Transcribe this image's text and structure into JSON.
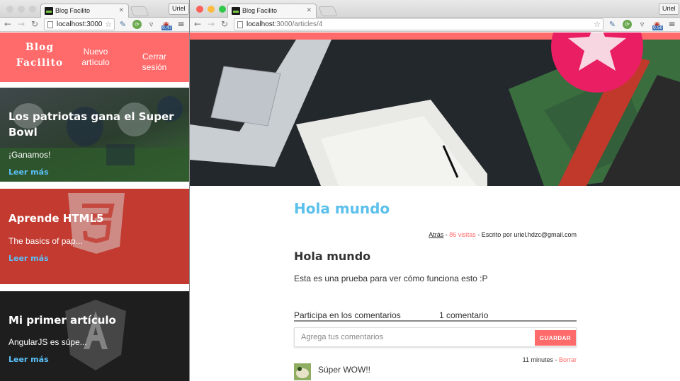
{
  "colors": {
    "brand": "#ff6b6b",
    "link": "#5bc0f8",
    "title": "#5bc0eb"
  },
  "left_window": {
    "tab_title": "Blog Facilito",
    "user": "Uriel",
    "url_host": "localhost:3000",
    "header": {
      "brand_line1": "Blog",
      "brand_line2": "Facilito",
      "nav_new_line1": "Nuevo",
      "nav_new_line2": "artículo",
      "nav_logout": "Cerrar sesión"
    },
    "cards": [
      {
        "title": "Los patriotas gana el Super Bowl",
        "excerpt": "¡Ganamos!",
        "link": "Leer más"
      },
      {
        "title": "Aprende HTML5",
        "excerpt": "The basics of pap...",
        "link": "Leer más"
      },
      {
        "title": "Mi primer artículo",
        "excerpt": "AngularJS es súpe...",
        "link": "Leer más"
      }
    ],
    "extension_badge": "0.47"
  },
  "right_window": {
    "tab_title": "Blog Facilito",
    "user": "Uriel",
    "url_host": "localhost",
    "url_path": ":3000/articles/4",
    "extension_badge": "0.50",
    "article": {
      "title": "Hola mundo",
      "meta_back": "Atrás",
      "meta_sep1": " - ",
      "meta_visits": "86 visitas",
      "meta_author": " - Escrito por uriel.hdzc@gmail.com",
      "subtitle": "Hola mundo",
      "body": "Esta es una prueba para ver cómo funciona esto :P"
    },
    "comments": {
      "heading": "Participa en los comentarios",
      "count": "1 comentario",
      "placeholder": "Agrega tus comentarios",
      "submit": "GUARDAR",
      "items": [
        {
          "time": "11 minutes",
          "sep": " - ",
          "delete": "Borrar",
          "text": "Súper WOW!!"
        }
      ]
    }
  },
  "icons": [
    "back-arrow-icon",
    "forward-arrow-icon",
    "reload-icon",
    "page-icon",
    "bookmark-star-icon",
    "eyedropper-icon",
    "green-extension-icon",
    "pocket-icon",
    "badge-extension-icon",
    "menu-icon",
    "close-icon"
  ]
}
